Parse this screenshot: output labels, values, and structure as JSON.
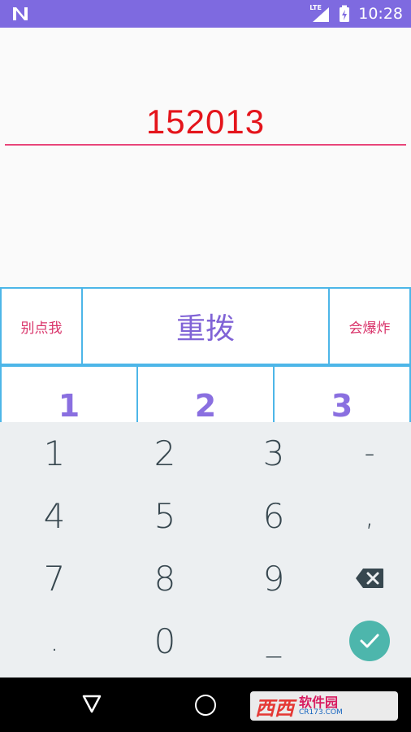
{
  "status_bar": {
    "time": "10:28",
    "network_label": "LTE",
    "icons": [
      "notification-n-icon",
      "lte-signal-icon",
      "battery-charging-icon"
    ]
  },
  "display": {
    "number": "152013"
  },
  "action_row": {
    "left_label": "别点我",
    "center_label": "重拨",
    "right_label": "会爆炸"
  },
  "dial_digits": [
    "1",
    "2",
    "3"
  ],
  "keyboard": {
    "rows": [
      [
        "1",
        "2",
        "3",
        "-"
      ],
      [
        "4",
        "5",
        "6",
        ","
      ],
      [
        "7",
        "8",
        "9",
        "backspace-icon"
      ],
      [
        ".",
        "0",
        "_",
        "enter-check-icon"
      ]
    ],
    "key_1": "1",
    "key_2": "2",
    "key_3": "3",
    "key_dash": "-",
    "key_4": "4",
    "key_5": "5",
    "key_6": "6",
    "key_comma": ",",
    "key_7": "7",
    "key_8": "8",
    "key_9": "9",
    "key_dot": ".",
    "key_0": "0",
    "key_space": "_",
    "enter_color": "#4db6ac"
  },
  "nav_bar": {
    "watermark_logo": "西西",
    "watermark_name": "软件园",
    "watermark_site": "CR173.COM"
  },
  "colors": {
    "accent": "#7e6ae0",
    "number": "#e4141b",
    "underline": "#e8457a",
    "cell_border": "#4db6e8"
  }
}
